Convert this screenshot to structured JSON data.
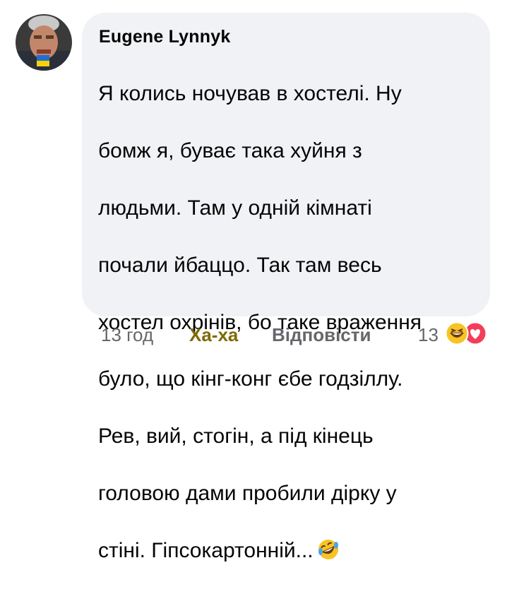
{
  "comment": {
    "author": "Eugene Lynnyk",
    "lines": [
      "Я колись ночував в хостелі. Ну",
      "бомж я, буває така хуйня з",
      "людьми. Там у одній кімнаті",
      "почали йбаццо. Так там весь",
      "хостел охрінів, бо таке враження",
      "було, що кінг-конг єбе годзіллу.",
      "Рев, вий, стогін, а під кінець",
      "головою дами пробили дірку у",
      "стіні. Гіпсокартонній..."
    ],
    "inline_emoji": "rolling-on-floor-laughing"
  },
  "actions": {
    "timestamp": "13 год",
    "reaction_label": "Ха-ха",
    "reply_label": "Відповісти",
    "reaction_count": "13",
    "reaction_types": [
      "haha",
      "love"
    ]
  },
  "colors": {
    "bubble": "#f0f2f5",
    "text": "#050505",
    "secondary": "#65676b",
    "haha_accent": "#7f6a05",
    "love_red": "#f33e58"
  }
}
